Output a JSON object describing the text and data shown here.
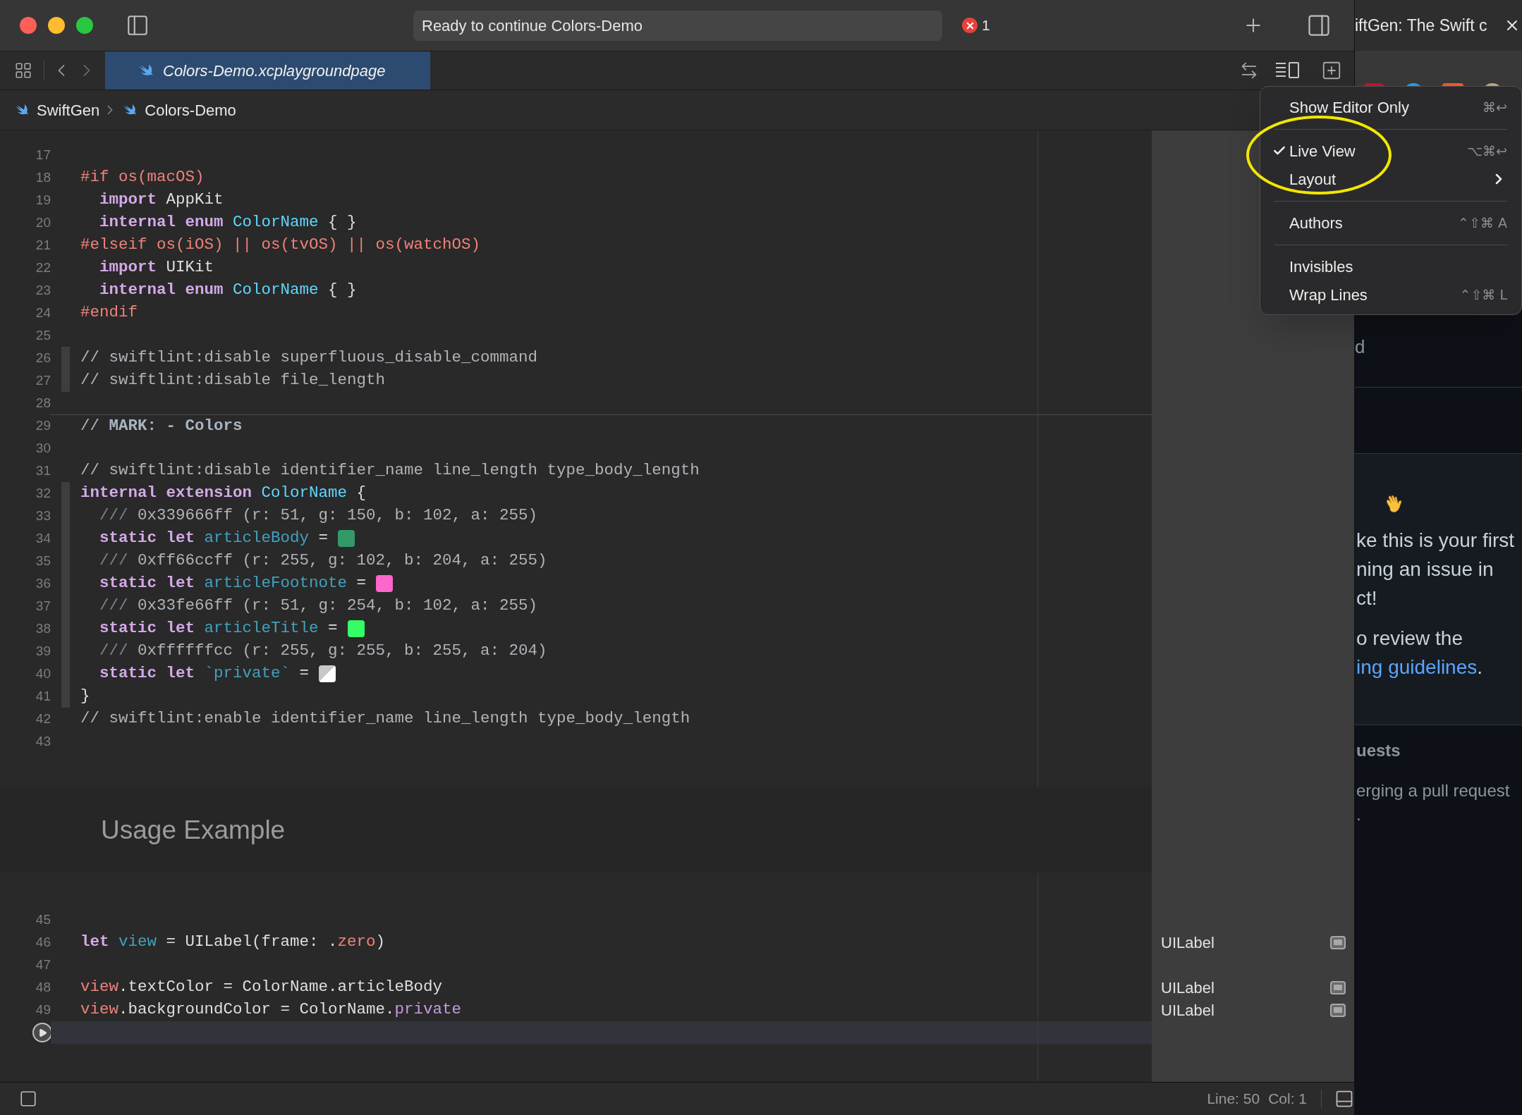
{
  "window": {
    "activity": "Ready to continue Colors-Demo",
    "error_count": "1"
  },
  "tabs": [
    {
      "label": "Colors-Demo.xcplaygroundpage",
      "selected": true
    }
  ],
  "breadcrumb": [
    "SwiftGen",
    "Colors-Demo"
  ],
  "code_top": {
    "lines": [
      {
        "number": "17",
        "ribbon": false,
        "current": false
      },
      {
        "number": "18",
        "ribbon": false,
        "current": false,
        "tokens": [
          {
            "kind": "directive",
            "text": "#if os(macOS)"
          }
        ]
      },
      {
        "number": "19",
        "ribbon": false,
        "current": false,
        "tokens": [
          {
            "kind": "keyword",
            "text": "  import"
          },
          {
            "kind": "plain",
            "text": " AppKit"
          }
        ]
      },
      {
        "number": "20",
        "ribbon": false,
        "current": false,
        "tokens": [
          {
            "kind": "keyword",
            "text": "  internal enum"
          },
          {
            "kind": "type",
            "text": " ColorName"
          },
          {
            "kind": "plain",
            "text": " { }"
          }
        ]
      },
      {
        "number": "21",
        "ribbon": false,
        "current": false,
        "tokens": [
          {
            "kind": "directive",
            "text": "#elseif os(iOS) || os(tvOS) || os(watchOS)"
          }
        ]
      },
      {
        "number": "22",
        "ribbon": false,
        "current": false,
        "tokens": [
          {
            "kind": "keyword",
            "text": "  import"
          },
          {
            "kind": "plain",
            "text": " UIKit"
          }
        ]
      },
      {
        "number": "23",
        "ribbon": false,
        "current": false,
        "tokens": [
          {
            "kind": "keyword",
            "text": "  internal enum"
          },
          {
            "kind": "type",
            "text": " ColorName"
          },
          {
            "kind": "plain",
            "text": " { }"
          }
        ]
      },
      {
        "number": "24",
        "ribbon": false,
        "current": false,
        "tokens": [
          {
            "kind": "directive",
            "text": "#endif"
          }
        ]
      },
      {
        "number": "25",
        "ribbon": false,
        "current": false
      },
      {
        "number": "26",
        "ribbon": true,
        "current": false,
        "tokens": [
          {
            "kind": "comment",
            "text": "// swiftlint:disable superfluous_disable_command"
          }
        ]
      },
      {
        "number": "27",
        "ribbon": true,
        "current": false,
        "tokens": [
          {
            "kind": "comment",
            "text": "// swiftlint:disable file_length"
          }
        ]
      },
      {
        "number": "28",
        "ribbon": false,
        "current": false
      },
      {
        "number": "29",
        "ribbon": false,
        "current": false,
        "tokens": [
          {
            "kind": "comment",
            "text": "// "
          },
          {
            "kind": "mark",
            "text": "MARK: - Colors"
          }
        ]
      },
      {
        "number": "30",
        "ribbon": false,
        "current": false
      },
      {
        "number": "31",
        "ribbon": false,
        "current": false,
        "tokens": [
          {
            "kind": "comment",
            "text": "// swiftlint:disable identifier_name line_length type_body_length"
          }
        ]
      },
      {
        "number": "32",
        "ribbon": true,
        "current": false,
        "tokens": [
          {
            "kind": "keyword",
            "text": "internal extension"
          },
          {
            "kind": "type",
            "text": " ColorName"
          },
          {
            "kind": "plain",
            "text": " {"
          }
        ]
      },
      {
        "number": "33",
        "ribbon": true,
        "current": false,
        "tokens": [
          {
            "kind": "doc",
            "text": "  ///"
          },
          {
            "kind": "comment",
            "text": " 0x339666ff (r: 51, g: 150, b: 102, a: 255)"
          }
        ]
      },
      {
        "number": "34",
        "ribbon": true,
        "current": false,
        "tokens": [
          {
            "kind": "keyword",
            "text": "  static let"
          },
          {
            "kind": "ident",
            "text": " articleBody"
          },
          {
            "kind": "plain",
            "text": " ="
          },
          {
            "kind": "swatch",
            "color": "#339966"
          }
        ]
      },
      {
        "number": "35",
        "ribbon": true,
        "current": false,
        "tokens": [
          {
            "kind": "doc",
            "text": "  ///"
          },
          {
            "kind": "comment",
            "text": " 0xff66ccff (r: 255, g: 102, b: 204, a: 255)"
          }
        ]
      },
      {
        "number": "36",
        "ribbon": true,
        "current": false,
        "tokens": [
          {
            "kind": "keyword",
            "text": "  static let"
          },
          {
            "kind": "ident",
            "text": " articleFootnote"
          },
          {
            "kind": "plain",
            "text": " ="
          },
          {
            "kind": "swatch",
            "color": "#ff66cc"
          }
        ]
      },
      {
        "number": "37",
        "ribbon": true,
        "current": false,
        "tokens": [
          {
            "kind": "doc",
            "text": "  ///"
          },
          {
            "kind": "comment",
            "text": " 0x33fe66ff (r: 51, g: 254, b: 102, a: 255)"
          }
        ]
      },
      {
        "number": "38",
        "ribbon": true,
        "current": false,
        "tokens": [
          {
            "kind": "keyword",
            "text": "  static let"
          },
          {
            "kind": "ident",
            "text": " articleTitle"
          },
          {
            "kind": "plain",
            "text": " ="
          },
          {
            "kind": "swatch",
            "color": "#33fe66"
          }
        ]
      },
      {
        "number": "39",
        "ribbon": true,
        "current": false,
        "tokens": [
          {
            "kind": "doc",
            "text": "  ///"
          },
          {
            "kind": "comment",
            "text": " 0xffffffcc (r: 255, g: 255, b: 255, a: 204)"
          }
        ]
      },
      {
        "number": "40",
        "ribbon": true,
        "current": false,
        "tokens": [
          {
            "kind": "keyword",
            "text": "  static let"
          },
          {
            "kind": "ident",
            "text": " `private`"
          },
          {
            "kind": "plain",
            "text": " ="
          },
          {
            "kind": "translucent-swatch",
            "color": "#ffffff"
          }
        ]
      },
      {
        "number": "41",
        "ribbon": true,
        "current": false,
        "tokens": [
          {
            "kind": "plain",
            "text": "}"
          }
        ]
      },
      {
        "number": "42",
        "ribbon": false,
        "current": false,
        "tokens": [
          {
            "kind": "comment",
            "text": "// swiftlint:enable identifier_name line_length type_body_length"
          }
        ]
      },
      {
        "number": "43",
        "ribbon": false,
        "current": false
      }
    ]
  },
  "usage_heading": "Usage Example",
  "code_bottom": {
    "lines": [
      {
        "number": "45",
        "current": false
      },
      {
        "number": "46",
        "current": false,
        "result": "UILabel",
        "tokens": [
          {
            "kind": "keyword",
            "text": "let"
          },
          {
            "kind": "ident",
            "text": " view"
          },
          {
            "kind": "plain",
            "text": " = UILabel(frame: ."
          },
          {
            "kind": "variable",
            "text": "zero"
          },
          {
            "kind": "plain",
            "text": ")"
          }
        ]
      },
      {
        "number": "47",
        "current": false
      },
      {
        "number": "48",
        "current": false,
        "result": "UILabel",
        "tokens": [
          {
            "kind": "variable",
            "text": "view"
          },
          {
            "kind": "plain",
            "text": ".textColor = ColorName.articleBody"
          }
        ]
      },
      {
        "number": "49",
        "current": false,
        "result": "UILabel",
        "tokens": [
          {
            "kind": "variable",
            "text": "view"
          },
          {
            "kind": "plain",
            "text": ".backgroundColor = ColorName."
          },
          {
            "kind": "member",
            "text": "private"
          }
        ]
      },
      {
        "current": true
      }
    ]
  },
  "status_bar": {
    "line": "Line: 50",
    "column": "Col: 1"
  },
  "menu": {
    "items": [
      {
        "kind": "item",
        "label": "Show Editor Only",
        "shortcut": "⌘↩",
        "checked": false,
        "submenu": false
      },
      {
        "kind": "separator"
      },
      {
        "kind": "item",
        "label": "Live View",
        "shortcut": "⌥⌘↩",
        "checked": true,
        "submenu": false
      },
      {
        "kind": "item",
        "label": "Layout",
        "checked": false,
        "submenu": true
      },
      {
        "kind": "separator"
      },
      {
        "kind": "item",
        "label": "Authors",
        "shortcut": "⌃⇧⌘ A",
        "checked": false,
        "submenu": false
      },
      {
        "kind": "separator"
      },
      {
        "kind": "item",
        "label": "Invisibles",
        "checked": false,
        "submenu": false
      },
      {
        "kind": "item",
        "label": "Wrap Lines",
        "shortcut": "⌃⇧⌘ L",
        "checked": false,
        "submenu": false
      }
    ]
  },
  "browser": {
    "tab_title": "iftGen: The Swift c",
    "top_fragment": "d",
    "welcome_lines": [
      "ke this is your first",
      "ning an issue in",
      "ct!"
    ],
    "review_line": "o review the",
    "link": "ing guidelines",
    "link_tail": ".",
    "section_heading": "uests",
    "section_lines": [
      "erging a pull request",
      "."
    ]
  }
}
